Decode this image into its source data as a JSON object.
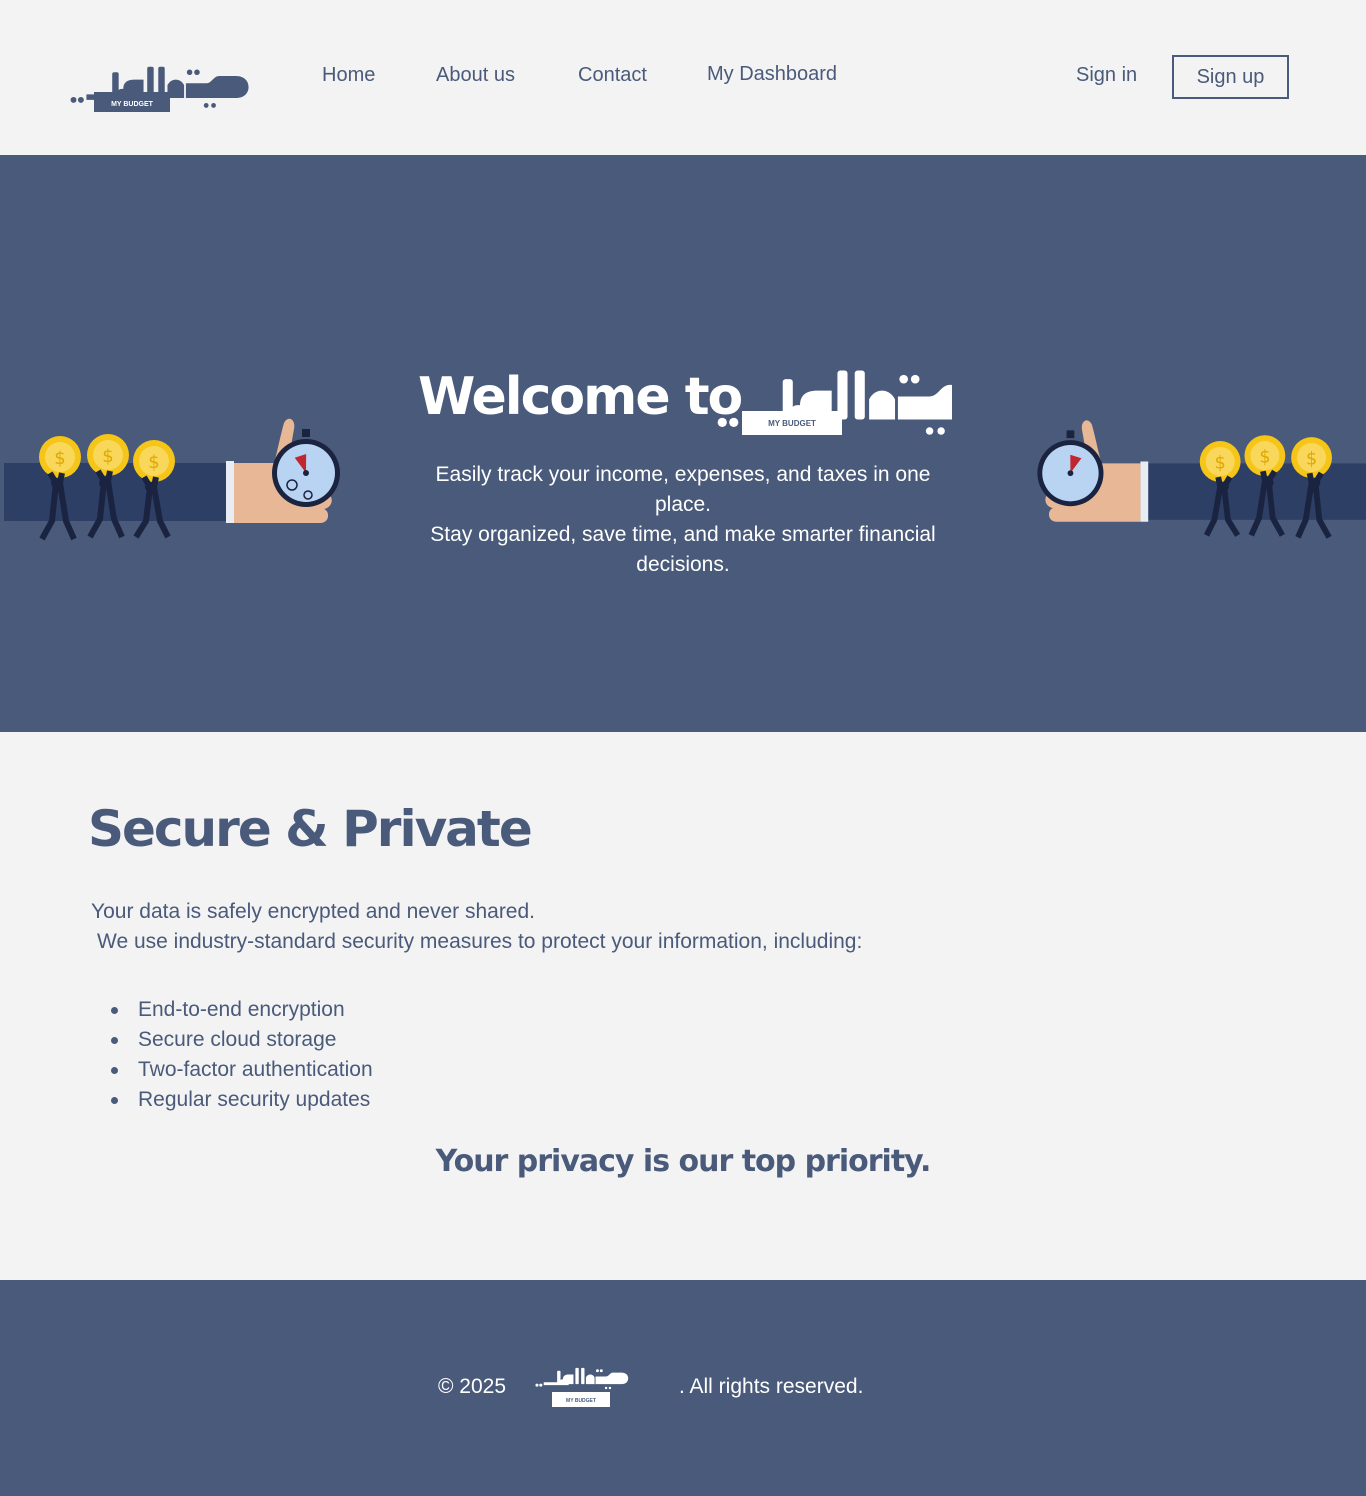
{
  "brand": {
    "logo_caption": "MY BUDGET",
    "colors": {
      "primary": "#4a5a7a",
      "background": "#f3f3f3",
      "coin": "#f5c518"
    }
  },
  "nav": {
    "links": [
      "Home",
      "About us",
      "Contact",
      "My Dashboard"
    ],
    "sign_in": "Sign in",
    "sign_up": "Sign up"
  },
  "hero": {
    "welcome": "Welcome to",
    "subtitle_line1": "Easily track your income, expenses, and taxes in one place.",
    "subtitle_line2": "Stay organized, save time, and make smarter financial decisions."
  },
  "secure": {
    "title": "Secure & Private",
    "line1": "Your data is safely encrypted and never shared.",
    "line2": "We use industry-standard security measures to protect your information, including:",
    "features": [
      "End-to-end encryption",
      "Secure cloud storage",
      "Two-factor authentication",
      "Regular security updates"
    ],
    "priority": "Your privacy is our top priority."
  },
  "footer": {
    "copyright": "© 2025",
    "rights": ". All rights reserved."
  }
}
